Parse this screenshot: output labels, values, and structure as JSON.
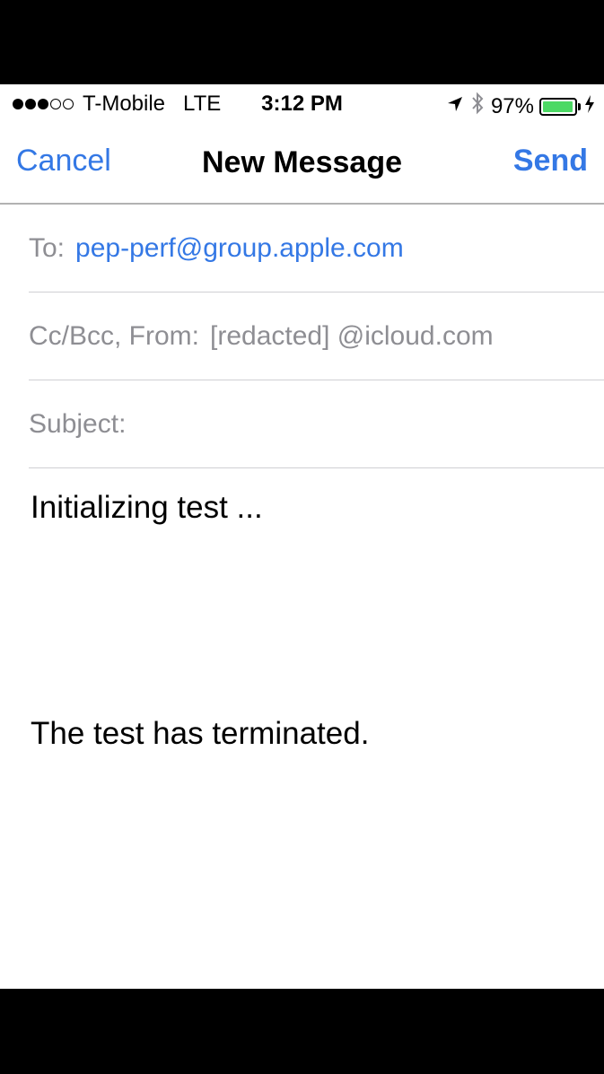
{
  "status_bar": {
    "carrier": "T-Mobile",
    "network": "LTE",
    "time": "3:12 PM",
    "battery_percent": "97%",
    "battery_level": 0.97,
    "signal_bars_filled": 3,
    "signal_bars_total": 5,
    "icons": [
      "location-arrow-icon",
      "bluetooth-icon",
      "battery-icon",
      "charging-bolt-icon"
    ]
  },
  "nav": {
    "cancel_label": "Cancel",
    "title": "New Message",
    "send_label": "Send"
  },
  "fields": {
    "to_label": "To:",
    "to_value": "pep-perf@group.apple.com",
    "ccbcc_label": "Cc/Bcc, From:",
    "from_value": "[redacted]  @icloud.com",
    "subject_label": "Subject:",
    "subject_value": ""
  },
  "body": {
    "line1": "Initializing test ...",
    "line2": "The test has terminated."
  },
  "colors": {
    "accent": "#3478e5",
    "label_gray": "#8e8e93",
    "battery_green": "#4cd964"
  }
}
